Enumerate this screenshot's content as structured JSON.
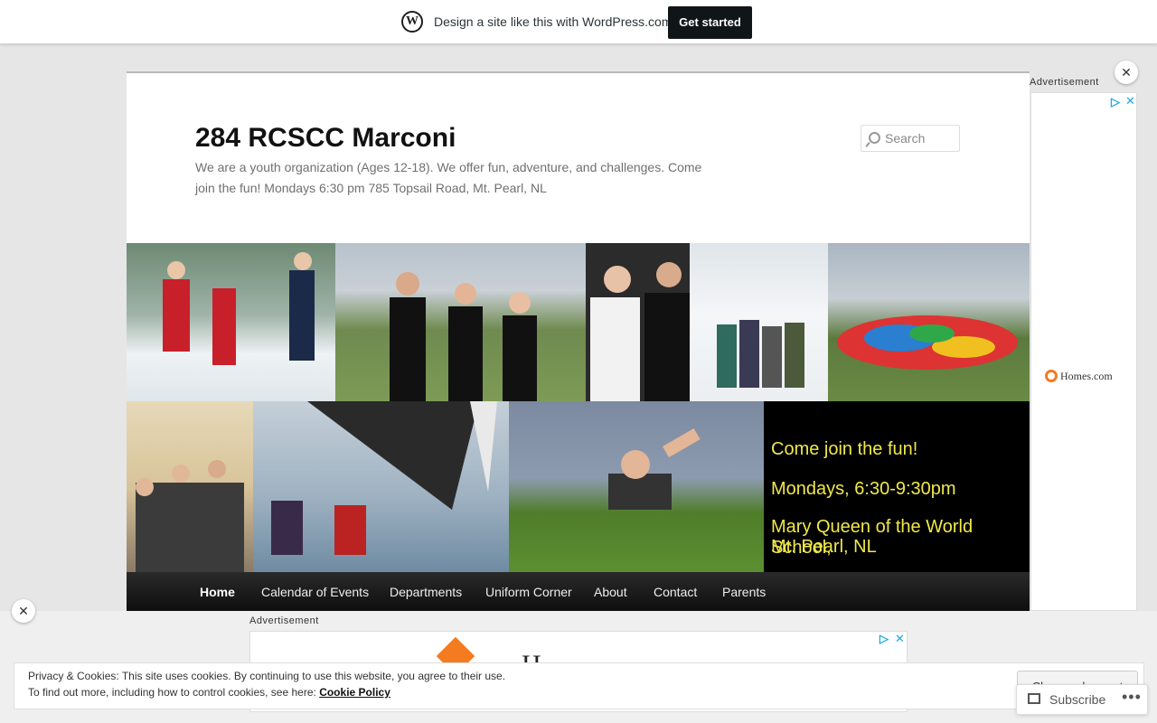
{
  "wp_bar": {
    "text": "Design a site like this with WordPress.com",
    "cta": "Get started",
    "logo_icon": "wordpress-logo-icon"
  },
  "site": {
    "title": "284 RCSCC Marconi",
    "description": "We are a youth organization (Ages 12-18). We offer fun, adventure, and challenges. Come join the fun! Mondays 6:30 pm 785 Topsail Road, Mt. Pearl, NL",
    "search_placeholder": "Search"
  },
  "header_image": {
    "lines": [
      "Come join the fun!",
      "Mondays, 6:30-9:30pm",
      "Mary Queen of the World School,",
      "Mt. Pearl, NL"
    ]
  },
  "nav": {
    "items": [
      "Home",
      "Calendar of Events",
      "Departments",
      "Uniform Corner",
      "About",
      "Contact",
      "Parents"
    ],
    "active": "Home"
  },
  "ads": {
    "label": "Advertisement",
    "right_brand": "Homes.com",
    "bottom_brand_partial": "H"
  },
  "cookie": {
    "line1": "Privacy & Cookies: This site uses cookies. By continuing to use this website, you agree to their use.",
    "line2_prefix": "To find out more, including how to control cookies, see here:",
    "link": "Cookie Policy",
    "button": "Close and accept"
  },
  "subscribe": {
    "label": "Subscribe",
    "more": "•••"
  },
  "colors": {
    "accent_text": "#f0e84a",
    "cta_bg": "#101517",
    "nav_bg": "#1a1a1a"
  }
}
